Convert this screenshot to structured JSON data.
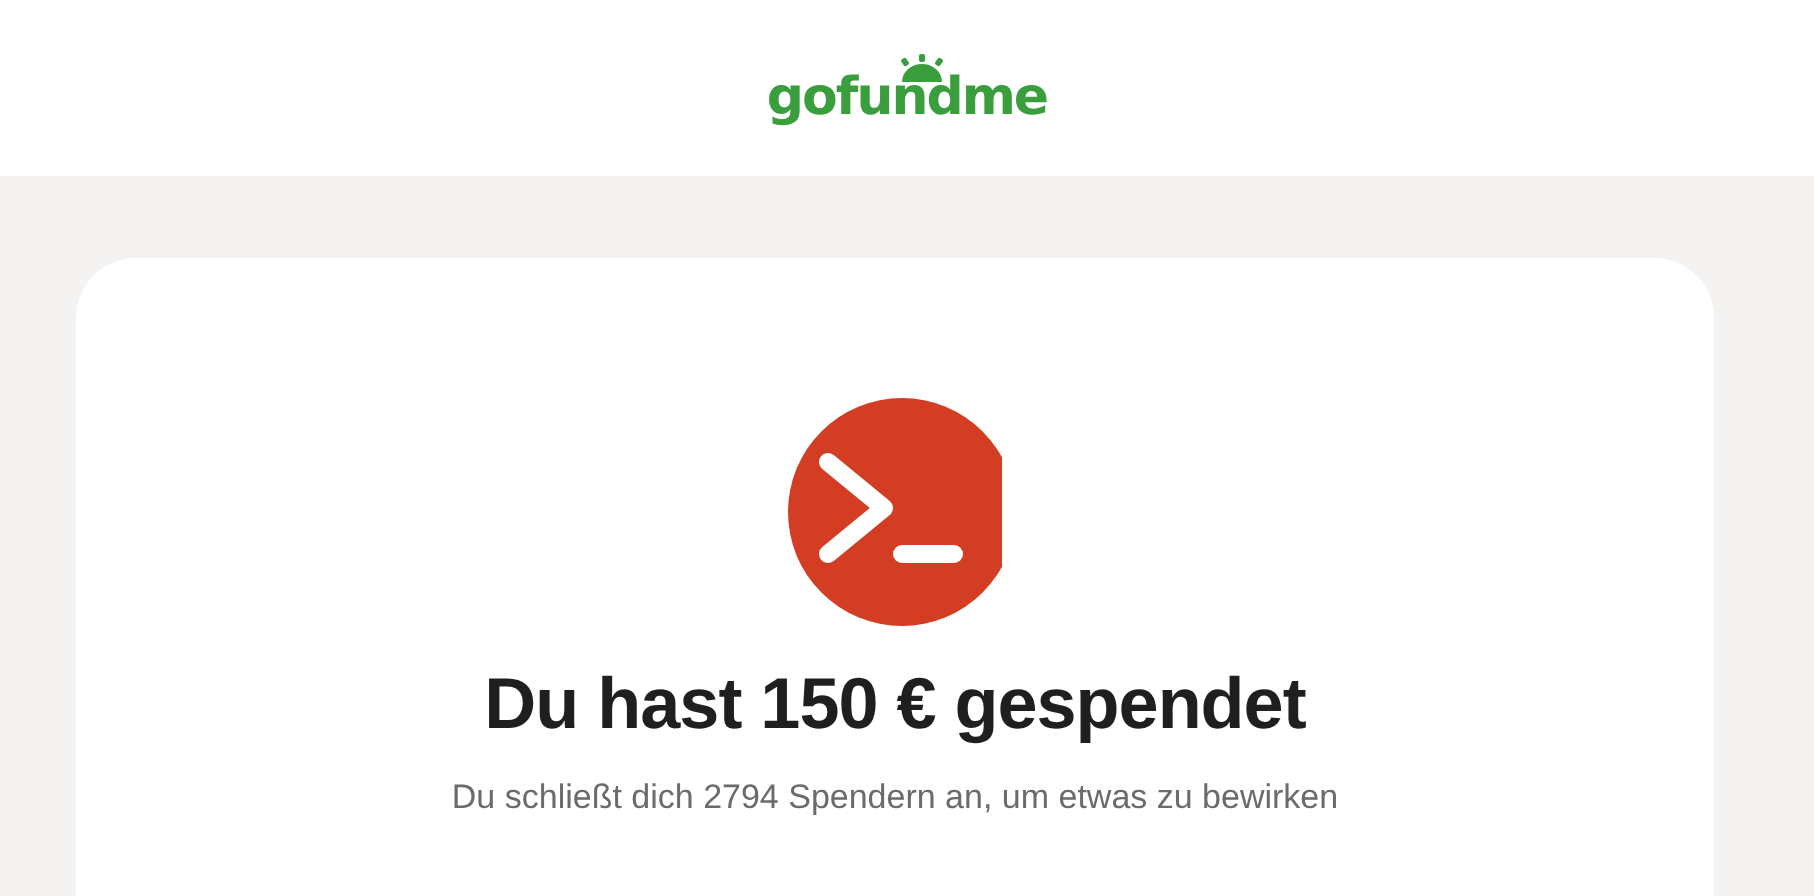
{
  "header": {
    "logo": "gofundme"
  },
  "confirmation": {
    "title": "Du hast 150 € gespendet",
    "subtitle": "Du schließt dich 2794 Spendern an, um etwas zu bewirken"
  }
}
